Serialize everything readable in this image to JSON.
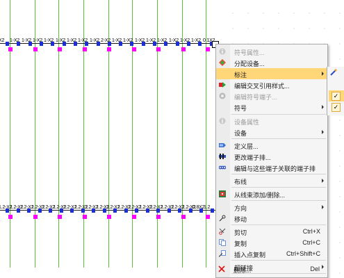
{
  "canvas": {
    "top_strip_labels": [
      "X2",
      "1-X2",
      "1-X2",
      "1-X2",
      "1-X2",
      "1-X2",
      "1-X2",
      "1-X2",
      "1-X2",
      "2-X2",
      "1-X2",
      "1-X2",
      "1-X2",
      "1-X2",
      "1-X2",
      "1-X2",
      "1-X2",
      "1-X2",
      "0.1X2"
    ],
    "bottom_strip_labels": [
      "1.2-X2",
      "1.2-X2",
      "1.2-X2",
      "1.2-X2",
      "1.2-X2",
      "1.2-X2",
      "1.2-X2",
      "1.2-X2",
      "1.2-X2",
      "1.2-X2",
      "1.2-X2",
      "1.2-X2",
      "1.2-X2",
      "1.2-X2",
      "1.2-X2",
      "1.2-X2",
      "1.2-X2",
      "1.2-X2",
      "0.8X2",
      "1.2"
    ],
    "wire_color": "#5cbf3a",
    "terminal_color": "#1a2fd6",
    "connection_color": "#ff00ff"
  },
  "menu": {
    "items": [
      {
        "label": "符号属性...",
        "icon": "info-icon",
        "disabled": true
      },
      {
        "label": "分配设备...",
        "icon": "diamond-icon",
        "disabled": false
      },
      {
        "label": "标注",
        "icon": "",
        "submenu": true,
        "highlighted": true
      },
      {
        "label": "编辑交叉引用样式...",
        "icon": "cross-ref-icon",
        "disabled": false
      },
      {
        "label": "编辑符号端子...",
        "icon": "terminal-gear-icon",
        "disabled": true
      },
      {
        "label": "符号",
        "icon": "",
        "submenu": true
      },
      {
        "label": "设备属性",
        "icon": "info-icon",
        "disabled": true
      },
      {
        "label": "设备",
        "icon": "",
        "submenu": true
      },
      {
        "label": "定义层...",
        "icon": "layer-icon",
        "disabled": false
      },
      {
        "label": "更改端子排...",
        "icon": "terminal-strip-icon",
        "disabled": false
      },
      {
        "label": "编辑与这些端子关联的端子排",
        "icon": "terminal-link-icon",
        "disabled": false
      },
      {
        "label": "布线",
        "icon": "",
        "submenu": true
      },
      {
        "label": "从线束添加/删除...",
        "icon": "harness-icon",
        "disabled": false
      },
      {
        "label": "方向",
        "icon": "",
        "submenu": true
      },
      {
        "label": "移动",
        "icon": "move-icon",
        "disabled": false
      },
      {
        "label": "剪切",
        "icon": "scissors-icon",
        "shortcut": "Ctrl+X"
      },
      {
        "label": "复制",
        "icon": "copy-icon",
        "shortcut": "Ctrl+C"
      },
      {
        "label": "插入点复制",
        "icon": "copy-point-icon",
        "shortcut": "Ctrl+Shift+C"
      },
      {
        "label": "超链接",
        "icon": "",
        "submenu": true
      },
      {
        "label": "删除...",
        "icon": "delete-icon",
        "shortcut": "Del"
      }
    ]
  },
  "submenu": {
    "checks": [
      "✓",
      "✓"
    ]
  }
}
